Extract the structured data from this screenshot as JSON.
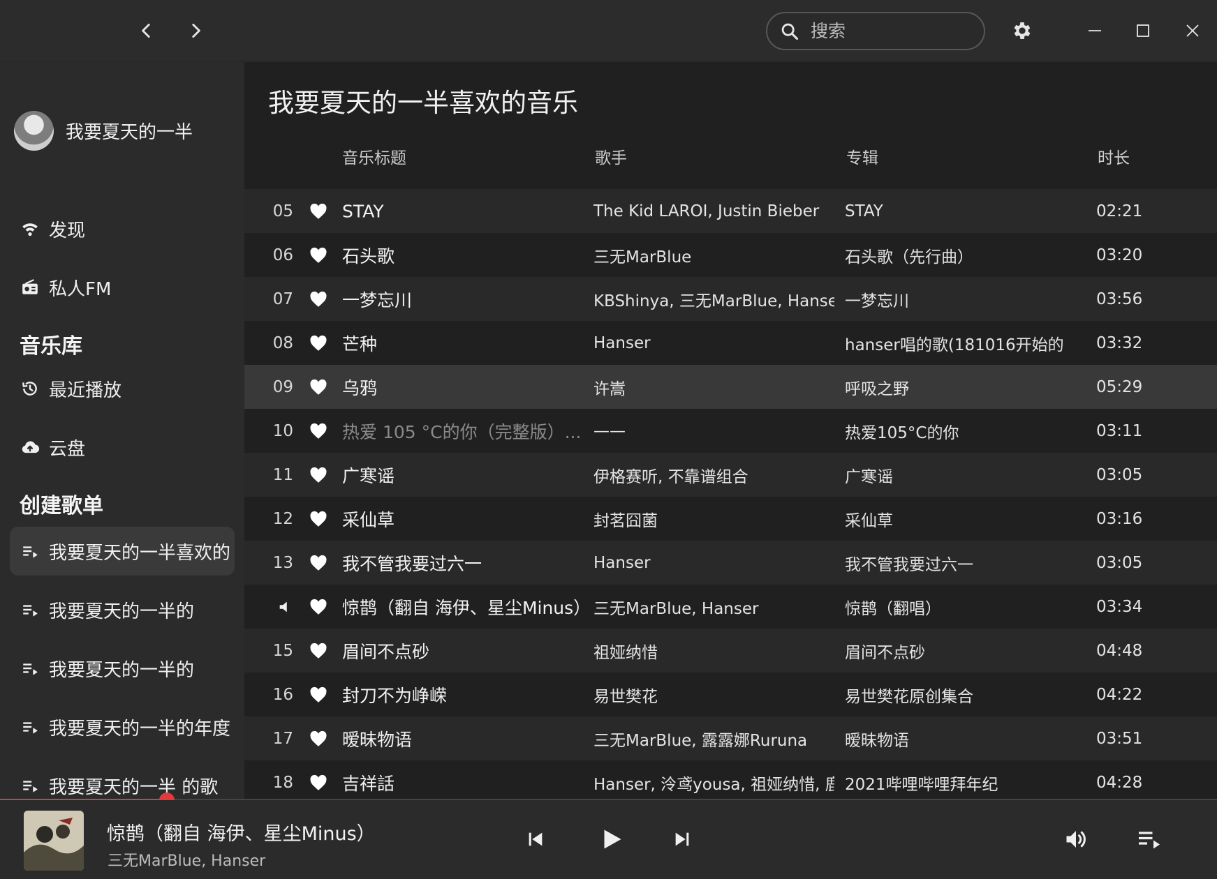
{
  "window": {
    "search_placeholder": "搜索",
    "colors": {
      "accent": "#e23a3a",
      "bg_main": "#202020",
      "bg_sidebar": "#2b2b2b"
    }
  },
  "sidebar": {
    "user_name": "我要夏天的一半",
    "nav": [
      {
        "label": "发现",
        "icon": "discover-icon"
      },
      {
        "label": "私人FM",
        "icon": "radio-icon"
      }
    ],
    "library_heading": "音乐库",
    "library": [
      {
        "label": "最近播放",
        "icon": "history-icon"
      },
      {
        "label": "云盘",
        "icon": "cloud-upload-icon"
      }
    ],
    "playlists_heading": "创建歌单",
    "playlists": [
      {
        "label": "我要夏天的一半喜欢的",
        "active": true
      },
      {
        "label": "我要夏天的一半的",
        "active": false
      },
      {
        "label": "我要夏天的一半的",
        "active": false
      },
      {
        "label": "我要夏天的一半的年度",
        "active": false
      },
      {
        "label": "我要夏天的一半 的歌",
        "active": false
      }
    ]
  },
  "main": {
    "title": "我要夏天的一半喜欢的音乐",
    "columns": {
      "title": "音乐标题",
      "artist": "歌手",
      "album": "专辑",
      "duration": "时长"
    },
    "tracks": [
      {
        "idx": "05",
        "title": "STAY",
        "artist": "The Kid LAROI, Justin Bieber",
        "album": "STAY",
        "duration": "02:21"
      },
      {
        "idx": "06",
        "title": "石头歌",
        "artist": "三无MarBlue",
        "album": "石头歌（先行曲）",
        "duration": "03:20"
      },
      {
        "idx": "07",
        "title": "一梦忘川",
        "artist": "KBShinya, 三无MarBlue, Hanser, ...",
        "album": "一梦忘川",
        "duration": "03:56"
      },
      {
        "idx": "08",
        "title": "芒种",
        "artist": "Hanser",
        "album": "hanser唱的歌(181016开始的",
        "duration": "03:32"
      },
      {
        "idx": "09",
        "title": "乌鸦",
        "artist": "许嵩",
        "album": "呼吸之野",
        "duration": "05:29"
      },
      {
        "idx": "10",
        "title": "热爱 105 °C的你（完整版）...",
        "artist": "——",
        "album": "热爱105°C的你",
        "duration": "03:11"
      },
      {
        "idx": "11",
        "title": "广寒谣",
        "artist": "伊格赛听, 不靠谱组合",
        "album": "广寒谣",
        "duration": "03:05"
      },
      {
        "idx": "12",
        "title": "采仙草",
        "artist": "封茗囧菌",
        "album": "采仙草",
        "duration": "03:16"
      },
      {
        "idx": "13",
        "title": "我不管我要过六一",
        "artist": "Hanser",
        "album": "我不管我要过六一",
        "duration": "03:05"
      },
      {
        "idx": "",
        "title": "惊鹊（翻自 海伊、星尘Minus）",
        "artist": "三无MarBlue, Hanser",
        "album": "惊鹊（翻唱）",
        "duration": "03:34"
      },
      {
        "idx": "15",
        "title": "眉间不点砂",
        "artist": "祖娅纳惜",
        "album": "眉间不点砂",
        "duration": "04:48"
      },
      {
        "idx": "16",
        "title": "封刀不为峥嵘",
        "artist": "易世樊花",
        "album": "易世樊花原创集合",
        "duration": "04:22"
      },
      {
        "idx": "17",
        "title": "暧昧物语",
        "artist": "三无MarBlue, 露露娜Ruruna",
        "album": "暧昧物语",
        "duration": "03:51"
      },
      {
        "idx": "18",
        "title": "吉祥話",
        "artist": "Hanser, 泠鸢yousa, 祖娅纳惜, 鹿乃",
        "album": "2021哔哩哔哩拜年纪",
        "duration": "04:28"
      }
    ]
  },
  "player": {
    "title": "惊鹊（翻自 海伊、星尘Minus）",
    "artist": "三无MarBlue, Hanser",
    "progress": 0.137
  }
}
